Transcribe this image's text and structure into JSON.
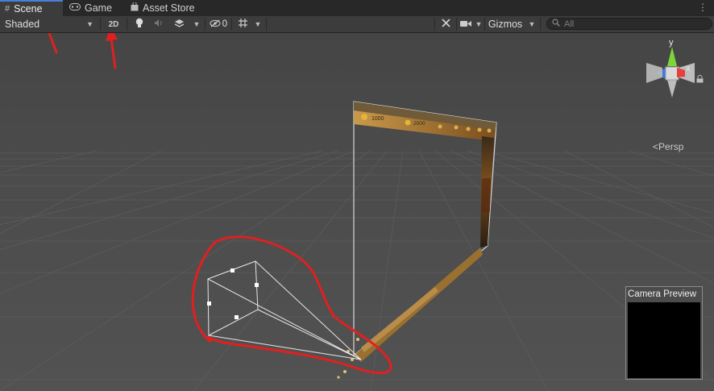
{
  "tabs": [
    {
      "label": "Scene",
      "icon": "grid-icon",
      "active": true
    },
    {
      "label": "Game",
      "icon": "gamepad-icon",
      "active": false
    },
    {
      "label": "Asset Store",
      "icon": "shopping-bag-icon",
      "active": false
    }
  ],
  "toolbar": {
    "draw_mode": "Shaded",
    "mode_2d": "2D",
    "hidden_count": "0",
    "gizmos": "Gizmos",
    "search_placeholder": "All"
  },
  "viewport": {
    "projection_label": "Persp",
    "axes": {
      "y": "y",
      "x": "x"
    },
    "camera_preview_title": "Camera Preview",
    "ui_canvas": {
      "coin_value": "1000",
      "gem_value": "2000"
    }
  },
  "colors": {
    "annotation_red": "#e02020",
    "axis_y": "#7cd63a",
    "axis_x": "#e5403a",
    "axis_z": "#3e7ae0",
    "accent": "#4a7fd9"
  }
}
